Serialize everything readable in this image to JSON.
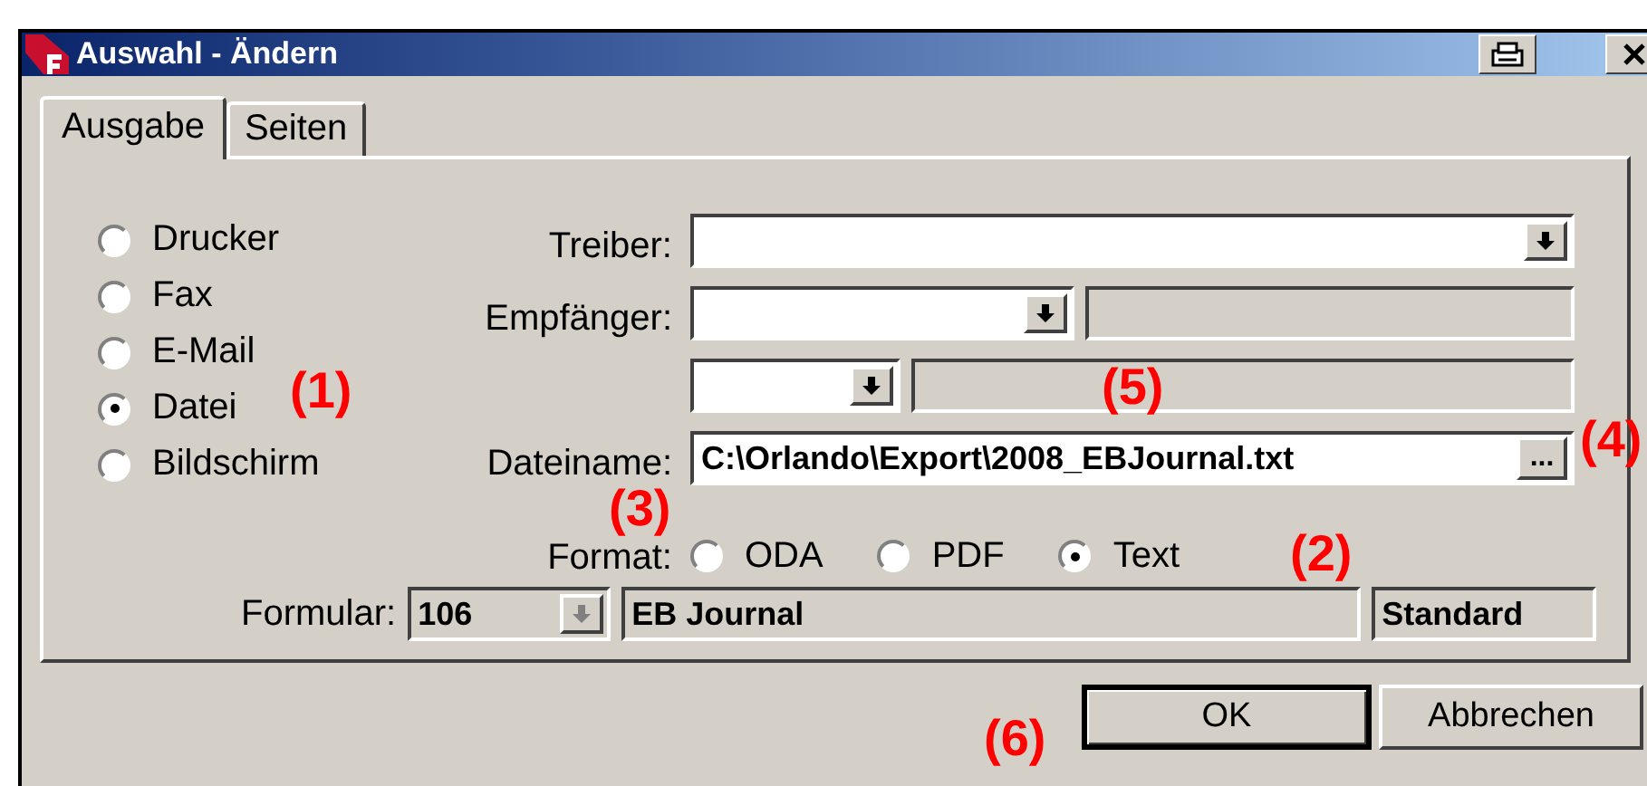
{
  "window": {
    "title": "Auswahl - Ändern"
  },
  "tabs": [
    {
      "label": "Ausgabe",
      "selected": true
    },
    {
      "label": "Seiten",
      "selected": false
    }
  ],
  "output_targets": [
    {
      "label": "Drucker",
      "selected": false
    },
    {
      "label": "Fax",
      "selected": false
    },
    {
      "label": "E-Mail",
      "selected": false
    },
    {
      "label": "Datei",
      "selected": true
    },
    {
      "label": "Bildschirm",
      "selected": false
    }
  ],
  "driver": {
    "label": "Treiber:"
  },
  "recipient": {
    "label": "Empfänger:"
  },
  "filename": {
    "label": "Dateiname:",
    "value": "C:\\Orlando\\Export\\2008_EBJournal.txt",
    "browse": "..."
  },
  "format": {
    "label": "Format:",
    "options": [
      {
        "label": "ODA",
        "selected": false
      },
      {
        "label": "PDF",
        "selected": false
      },
      {
        "label": "Text",
        "selected": true
      }
    ]
  },
  "form": {
    "label": "Formular:",
    "number": "106",
    "name": "EB Journal",
    "variant": "Standard",
    "disabled": true
  },
  "buttons": [
    {
      "label": "OK",
      "default": true
    },
    {
      "label": "Abbrechen",
      "default": false
    }
  ],
  "annotations": [
    {
      "text": "(1)"
    },
    {
      "text": "(5)"
    },
    {
      "text": "(4)"
    },
    {
      "text": "(3)"
    },
    {
      "text": "(2)"
    },
    {
      "text": "(6)"
    }
  ]
}
